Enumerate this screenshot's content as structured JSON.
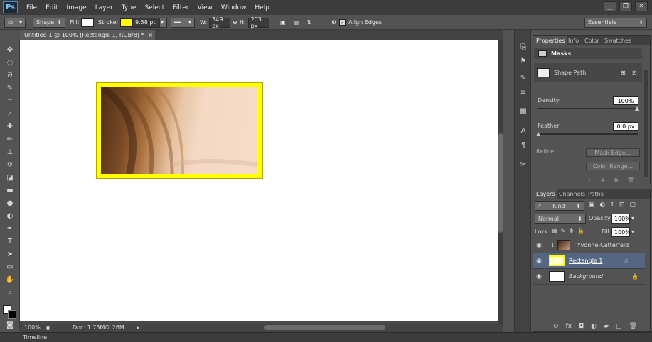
{
  "app": {
    "logo": "Ps",
    "menu": [
      "File",
      "Edit",
      "Image",
      "Layer",
      "Type",
      "Select",
      "Filter",
      "View",
      "Window",
      "Help"
    ],
    "window_controls": [
      "▁",
      "❐",
      "✕"
    ]
  },
  "options_bar": {
    "shape_mode": "Shape",
    "fill_label": "Fill:",
    "stroke_label": "Stroke:",
    "stroke_width": "9.58 pt",
    "w_label": "W:",
    "w_value": "349 px",
    "h_label": "H:",
    "h_value": "203 px",
    "align_edges": "Align Edges",
    "workspace": "Essentials",
    "stroke_color": "#ffff00",
    "fill_color": "#ffffff"
  },
  "document": {
    "tab_title": "Untitled-1 @ 100% (Rectangle 1, RGB/8) *",
    "zoom": "100%",
    "doc_info": "Doc: 1.75M/2.26M"
  },
  "timeline_label": "Timeline",
  "properties": {
    "tabs": [
      "Properties",
      "Info",
      "Color",
      "Swatches"
    ],
    "section": "Masks",
    "mask_type": "Shape Path",
    "density_label": "Density:",
    "density_value": "100%",
    "feather_label": "Feather:",
    "feather_value": "0.0 px",
    "refine_label": "Refine:",
    "mask_edge_button": "Mask Edge...",
    "color_range_button": "Color Range..."
  },
  "layers_panel": {
    "tabs": [
      "Layers",
      "Channels",
      "Paths"
    ],
    "kind_filter": "Kind",
    "blend_mode": "Normal",
    "opacity_label": "Opacity:",
    "opacity_value": "100%",
    "lock_label": "Lock:",
    "fill_label": "Fill:",
    "fill_value": "100%",
    "layers": [
      {
        "name": "Yvonne-Catterfeld",
        "selected": false
      },
      {
        "name": "Rectangle 1",
        "selected": true
      },
      {
        "name": "Background",
        "selected": false
      }
    ]
  },
  "colors": {
    "accent_selected_layer": "#556682",
    "rectangle_stroke": "#ffff00"
  }
}
